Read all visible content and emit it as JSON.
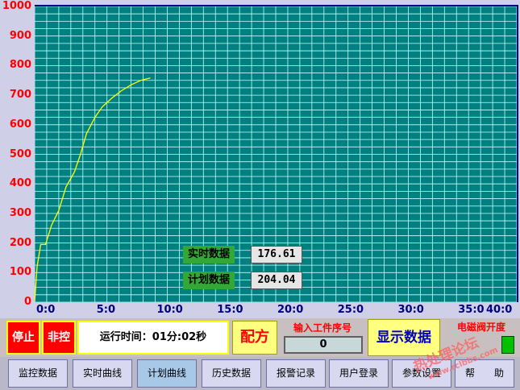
{
  "chart_data": {
    "type": "line",
    "yticks": [
      "1000",
      "900",
      "800",
      "700",
      "600",
      "500",
      "400",
      "300",
      "200",
      "100",
      "0"
    ],
    "xticks": [
      "0:0",
      "5:0",
      "10:0",
      "15:0",
      "20:0",
      "25:0",
      "30:0",
      "35:0",
      "40:0"
    ],
    "ylim": [
      0,
      1000
    ],
    "xlim": [
      0,
      40
    ],
    "grid": true,
    "series": [
      {
        "color": "#ffff00",
        "x": [
          0,
          0.2,
          0.5,
          0.9,
          1.4,
          2.0,
          2.6,
          3.3,
          3.8,
          4.3,
          5.0,
          5.6,
          6.4,
          7.2,
          8.0,
          8.8,
          9.6
        ],
        "y": [
          0,
          120,
          195,
          195,
          260,
          310,
          390,
          440,
          500,
          570,
          625,
          660,
          690,
          715,
          735,
          750,
          758
        ]
      }
    ]
  },
  "overlay": {
    "realtime_label": "实时数据",
    "realtime_value": "176.61",
    "plan_label": "计划数据",
    "plan_value": "204.04"
  },
  "controls": {
    "stop": "停止",
    "noncontrol": "非控",
    "runtime": "运行时间：01分:02秒",
    "recipe": "配方",
    "input_label": "输入工件序号",
    "input_value": "0",
    "show_data": "显示数据",
    "valve": "电磁阀开度"
  },
  "tabs": [
    "监控数据",
    "实时曲线",
    "计划曲线",
    "历史数据",
    "报警记录",
    "用户登录",
    "参数设置",
    "帮　　助"
  ],
  "watermark": {
    "text1": "热处理论坛",
    "text2": "www.rclbbs.com"
  },
  "colors": {
    "plot_bg": "#008080",
    "grid": "#c0ffff",
    "tick": "#ff0000",
    "curve": "#ffff00"
  }
}
